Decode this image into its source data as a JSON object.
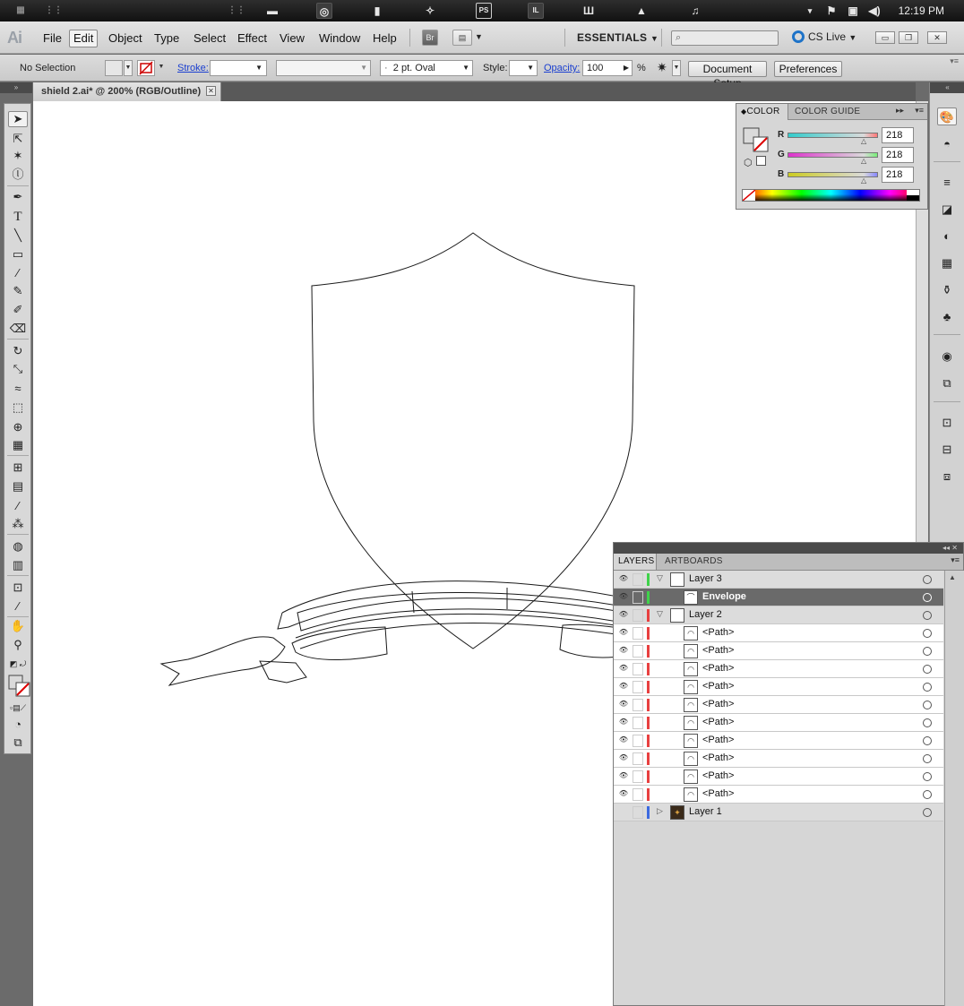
{
  "taskbar": {
    "clock": "12:19 PM",
    "apps": [
      "grid-icon",
      "folder-icon",
      "chrome-icon",
      "file-icon",
      "flow-icon",
      "photoshop-icon",
      "illustrator-icon",
      "unity-icon",
      "unity-alt-icon",
      "music-icon"
    ],
    "photoshop_label": "PS",
    "illustrator_label": "IL"
  },
  "menubar": {
    "logo": "Ai",
    "items": [
      "File",
      "Edit",
      "Object",
      "Type",
      "Select",
      "Effect",
      "View",
      "Window",
      "Help"
    ],
    "selected": "Edit",
    "bridge": "Br",
    "workspace": "ESSENTIALS",
    "cslive": "CS Live"
  },
  "controlbar": {
    "selection": "No Selection",
    "stroke_label": "Stroke:",
    "brush": "2 pt. Oval",
    "style_label": "Style:",
    "opacity_label": "Opacity:",
    "opacity_value": "100",
    "percent": "%",
    "document_setup": "Document Setup",
    "preferences": "Preferences"
  },
  "document": {
    "tab_title": "shield 2.ai* @ 200% (RGB/Outline)"
  },
  "color_panel": {
    "tab_color": "COLOR",
    "tab_guide": "COLOR GUIDE",
    "r_label": "R",
    "g_label": "G",
    "b_label": "B",
    "r": "218",
    "g": "218",
    "b": "218"
  },
  "layers_panel": {
    "tab_layers": "LAYERS",
    "tab_artboards": "ARTBOARDS",
    "rows": [
      {
        "name": "Layer 3",
        "level": 0,
        "expanded": true,
        "color": "#3fd24a"
      },
      {
        "name": "Envelope",
        "level": 1,
        "selected": true,
        "color": "#3fd24a"
      },
      {
        "name": "Layer 2",
        "level": 0,
        "expanded": true,
        "color": "#e84040"
      },
      {
        "name": "<Path>",
        "level": 1,
        "color": "#e84040"
      },
      {
        "name": "<Path>",
        "level": 1,
        "color": "#e84040"
      },
      {
        "name": "<Path>",
        "level": 1,
        "color": "#e84040"
      },
      {
        "name": "<Path>",
        "level": 1,
        "color": "#e84040"
      },
      {
        "name": "<Path>",
        "level": 1,
        "color": "#e84040"
      },
      {
        "name": "<Path>",
        "level": 1,
        "color": "#e84040"
      },
      {
        "name": "<Path>",
        "level": 1,
        "color": "#e84040"
      },
      {
        "name": "<Path>",
        "level": 1,
        "color": "#e84040"
      },
      {
        "name": "<Path>",
        "level": 1,
        "color": "#e84040"
      },
      {
        "name": "<Path>",
        "level": 1,
        "color": "#e84040"
      },
      {
        "name": "Layer 1",
        "level": 0,
        "expanded": false,
        "color": "#3c6ae0",
        "hidden": true
      }
    ]
  }
}
